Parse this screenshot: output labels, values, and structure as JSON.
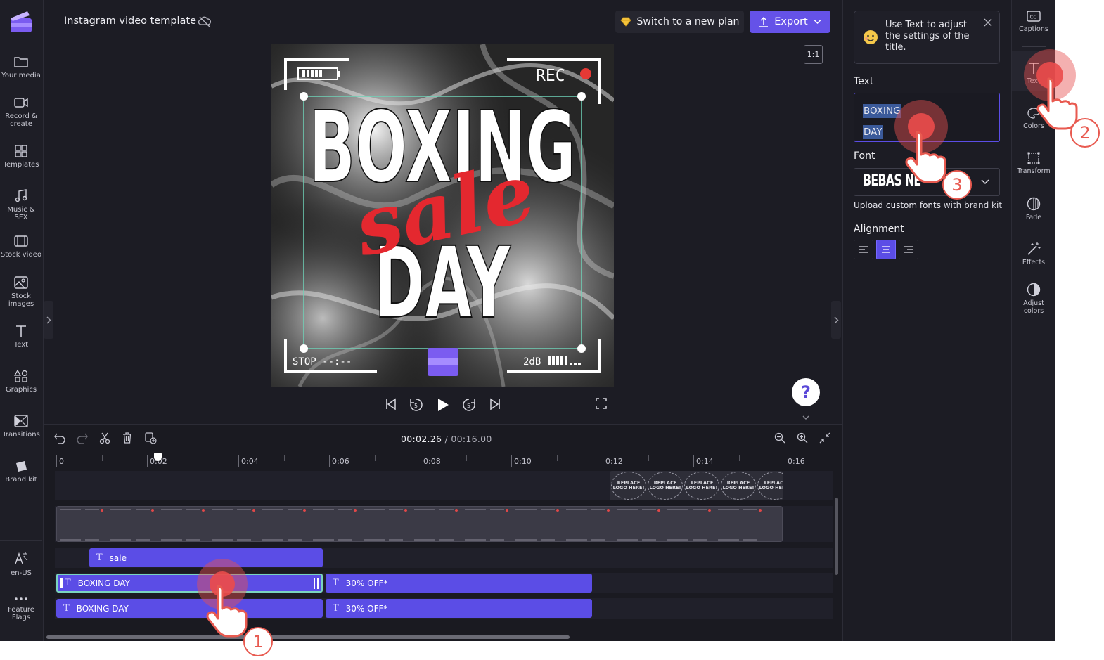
{
  "app": {
    "project_title": "Instagram video template",
    "brand_color": "#5b4de6"
  },
  "topbar": {
    "plan_label": "Switch to a new plan",
    "export_label": "Export"
  },
  "sidebar": {
    "items": [
      {
        "label": "Your media"
      },
      {
        "label": "Record & create"
      },
      {
        "label": "Templates"
      },
      {
        "label": "Music & SFX"
      },
      {
        "label": "Stock video"
      },
      {
        "label": "Stock images"
      },
      {
        "label": "Text"
      },
      {
        "label": "Graphics"
      },
      {
        "label": "Transitions"
      },
      {
        "label": "Brand kit"
      }
    ],
    "bottom": [
      {
        "label": "en-US"
      },
      {
        "label": "Feature Flags"
      }
    ]
  },
  "preview": {
    "ratio": "1:1",
    "rec_label": "REC",
    "stop_label": "STOP --:--",
    "db_label": "2dB",
    "title_line1": "BOXING",
    "title_line2": "DAY",
    "script_word": "sale"
  },
  "player": {
    "current_time": "00:02.26",
    "separator": " / ",
    "total_time": "00:16.00"
  },
  "timeline": {
    "ticks": [
      "0",
      "0:02",
      "0:04",
      "0:06",
      "0:08",
      "0:10",
      "0:12",
      "0:14",
      "0:16"
    ],
    "logo_placeholder": "REPLACE LOGO HERE!",
    "clips": [
      {
        "label": "sale"
      },
      {
        "label": "BOXING DAY"
      },
      {
        "label": "30% OFF*"
      },
      {
        "label": "BOXING DAY"
      },
      {
        "label": "30% OFF*"
      }
    ]
  },
  "properties": {
    "tip_text": "Use Text to adjust the settings of the title.",
    "text_section": "Text",
    "text_value_line1": "BOXING",
    "text_value_line2": "DAY",
    "font_section": "Font",
    "font_value": "BEBAS NE",
    "upload_link": "Upload custom fonts",
    "upload_suffix": " with brand kit",
    "alignment_section": "Alignment"
  },
  "rightbar": {
    "items": [
      {
        "label": "Captions"
      },
      {
        "label": "Text"
      },
      {
        "label": "Colors"
      },
      {
        "label": "Transform"
      },
      {
        "label": "Fade"
      },
      {
        "label": "Effects"
      },
      {
        "label": "Adjust colors"
      }
    ]
  },
  "annotations": {
    "step1": "1",
    "step2": "2",
    "step3": "3"
  }
}
